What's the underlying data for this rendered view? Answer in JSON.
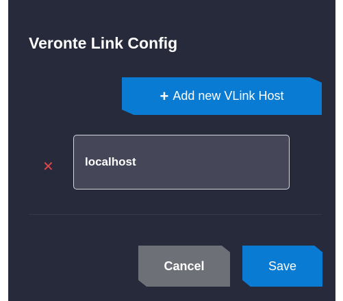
{
  "dialog": {
    "title": "Veronte Link Config",
    "add_host_button": {
      "icon": "plus-icon",
      "icon_glyph": "+",
      "label": "Add new VLink Host"
    },
    "hosts": [
      {
        "remove_icon": "close-icon",
        "remove_glyph": "✕",
        "value": "localhost"
      }
    ],
    "footer": {
      "cancel_label": "Cancel",
      "save_label": "Save"
    }
  },
  "colors": {
    "background": "#272a3b",
    "primary": "#0a7bd2",
    "secondary": "#6e7078",
    "danger": "#e04646",
    "input_background": "#454758"
  }
}
